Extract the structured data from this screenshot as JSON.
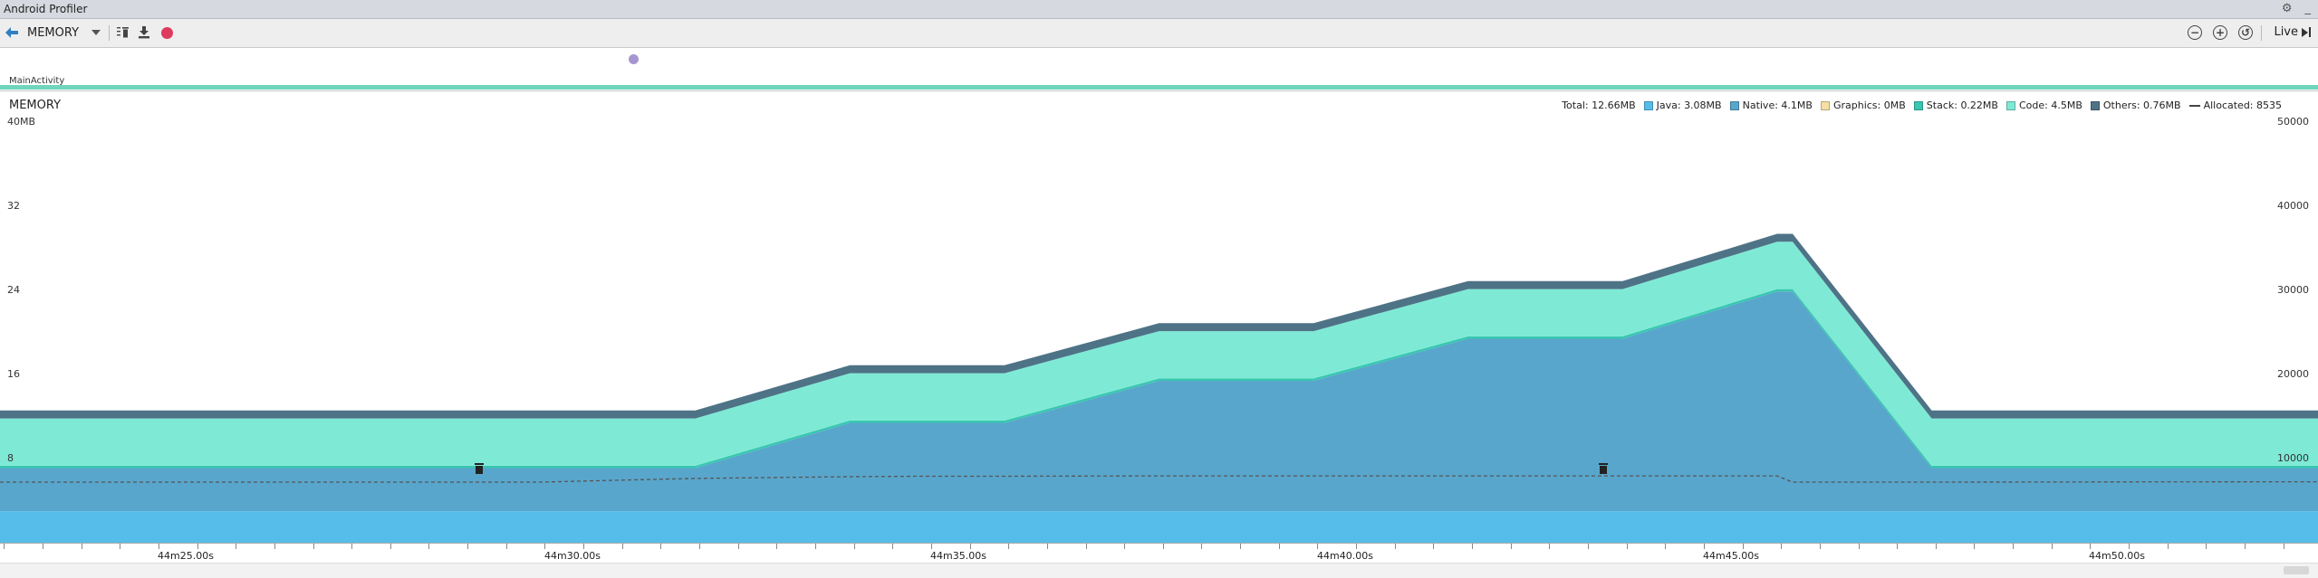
{
  "window": {
    "title": "Android Profiler"
  },
  "toolbar": {
    "back_icon": "back-arrow-icon",
    "monitor_select": "MEMORY",
    "force_gc_icon": "trash-icon",
    "dump_heap_icon": "download-icon",
    "record_icon": "record-icon",
    "live_label": "Live"
  },
  "events": {
    "activity_label": "MainActivity"
  },
  "memory": {
    "title": "MEMORY",
    "legend": {
      "total": "Total: 12.66MB",
      "items": [
        {
          "label": "Java: 3.08MB",
          "color": "#56bdea"
        },
        {
          "label": "Native: 4.1MB",
          "color": "#59a6cc"
        },
        {
          "label": "Graphics: 0MB",
          "color": "#f6dfa4"
        },
        {
          "label": "Stack: 0.22MB",
          "color": "#38c7b0"
        },
        {
          "label": "Code: 4.5MB",
          "color": "#7eead6"
        },
        {
          "label": "Others: 0.76MB",
          "color": "#4e7386"
        }
      ],
      "allocated": "Allocated: 8535"
    }
  },
  "chart_data": {
    "type": "area",
    "stacked": true,
    "x_unit": "seconds",
    "x": [
      -60,
      -56,
      -54.3,
      -50,
      -46,
      -46,
      -44.3,
      -42,
      -38,
      -38,
      -36.3,
      -34,
      -30,
      -30,
      -28.3,
      -26,
      -22,
      -22,
      -20.3,
      -18,
      -14,
      -14,
      -13.6,
      -10,
      0
    ],
    "series": [
      {
        "name": "Java",
        "color": "#56bdea",
        "values": [
          3.0,
          3.0,
          3.0,
          3.0,
          3.0,
          3.0,
          3.0,
          3.0,
          3.0,
          3.0,
          3.0,
          3.0,
          3.0,
          3.0,
          3.0,
          3.0,
          3.0,
          3.0,
          3.0,
          3.0,
          3.0,
          3.0,
          3.0,
          3.0,
          3.0
        ]
      },
      {
        "name": "Native",
        "color": "#59a6cc",
        "values": [
          4.1,
          4.1,
          4.1,
          4.1,
          4.1,
          4.1,
          4.1,
          4.1,
          8.4,
          8.4,
          8.4,
          8.4,
          12.4,
          12.4,
          12.4,
          12.4,
          16.4,
          16.4,
          16.4,
          16.4,
          20.9,
          20.9,
          20.9,
          4.1,
          4.1
        ]
      },
      {
        "name": "Graphics",
        "color": "#f6dfa4",
        "values": [
          0,
          0,
          0,
          0,
          0,
          0,
          0,
          0,
          0,
          0,
          0,
          0,
          0,
          0,
          0,
          0,
          0,
          0,
          0,
          0,
          0,
          0,
          0,
          0,
          0
        ]
      },
      {
        "name": "Stack",
        "color": "#38c7b0",
        "values": [
          0.22,
          0.22,
          0.22,
          0.22,
          0.22,
          0.22,
          0.22,
          0.22,
          0.22,
          0.22,
          0.22,
          0.22,
          0.22,
          0.22,
          0.22,
          0.22,
          0.22,
          0.22,
          0.22,
          0.22,
          0.22,
          0.22,
          0.22,
          0.22,
          0.22
        ]
      },
      {
        "name": "Code",
        "color": "#7eead6",
        "values": [
          4.5,
          4.5,
          4.5,
          4.5,
          4.5,
          4.5,
          4.5,
          4.5,
          4.5,
          4.5,
          4.5,
          4.5,
          4.5,
          4.5,
          4.5,
          4.5,
          4.5,
          4.5,
          4.5,
          4.5,
          4.5,
          4.5,
          4.5,
          4.5,
          4.5
        ]
      },
      {
        "name": "Others",
        "color": "#4e7386",
        "values": [
          0.76,
          0.76,
          0.76,
          0.76,
          0.76,
          0.76,
          0.76,
          0.76,
          0.76,
          0.76,
          0.76,
          0.76,
          0.76,
          0.76,
          0.76,
          0.76,
          0.76,
          0.76,
          0.76,
          0.76,
          0.76,
          0.76,
          0.76,
          0.76,
          0.76
        ]
      }
    ],
    "allocated": {
      "name": "Allocated",
      "values": [
        7200,
        7200,
        7200,
        7200,
        7200,
        7200,
        7400,
        7650,
        7850,
        7850,
        7900,
        7900,
        7950,
        7950,
        7950,
        7950,
        7950,
        7950,
        7950,
        7950,
        7950,
        7950,
        7200,
        7200,
        7250
      ]
    },
    "y_left_ticks": [
      "40MB",
      "32",
      "24",
      "16",
      "8"
    ],
    "y_right_ticks": [
      "50000",
      "40000",
      "30000",
      "20000",
      "10000"
    ],
    "ylim_left": [
      0,
      40
    ],
    "ylim_right": [
      0,
      50000
    ],
    "x_ticks": [
      "44m25.00s",
      "44m30.00s",
      "44m35.00s",
      "44m40.00s",
      "44m45.00s",
      "44m50.00s"
    ],
    "gc_events_x": [
      -47.6,
      -18.5
    ],
    "legend_position": "top-right"
  }
}
